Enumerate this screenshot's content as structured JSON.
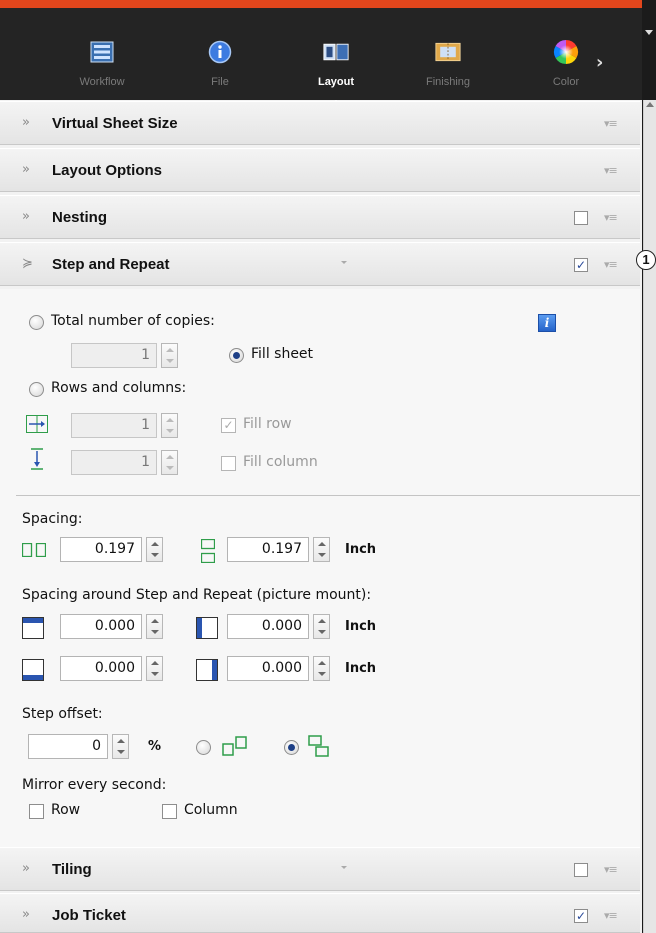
{
  "tabs": [
    {
      "label": "Workflow",
      "icon": "workflow-icon"
    },
    {
      "label": "File",
      "icon": "info-icon"
    },
    {
      "label": "Layout",
      "icon": "layout-icon",
      "active": true
    },
    {
      "label": "Finishing",
      "icon": "finishing-icon"
    },
    {
      "label": "Color",
      "icon": "color-wheel-icon"
    }
  ],
  "sections": {
    "virtual_sheet_size": {
      "title": "Virtual Sheet Size"
    },
    "layout_options": {
      "title": "Layout Options"
    },
    "nesting": {
      "title": "Nesting",
      "checked": false
    },
    "step_and_repeat": {
      "title": "Step and Repeat",
      "checked": true,
      "badge": "1"
    },
    "tiling": {
      "title": "Tiling",
      "checked": false
    },
    "job_ticket": {
      "title": "Job Ticket",
      "checked": true
    }
  },
  "step_repeat": {
    "total_copies_label": "Total number of copies:",
    "total_copies_value": "1",
    "fill_sheet_label": "Fill sheet",
    "rows_columns_label": "Rows and columns:",
    "rows_value": "1",
    "fill_row_label": "Fill row",
    "columns_value": "1",
    "fill_column_label": "Fill column",
    "spacing_label": "Spacing:",
    "spacing_h_value": "0.197",
    "spacing_v_value": "0.197",
    "unit": "Inch",
    "mount_label": "Spacing around Step and Repeat (picture mount):",
    "mount_top_value": "0.000",
    "mount_left_value": "0.000",
    "mount_bottom_value": "0.000",
    "mount_right_value": "0.000",
    "step_offset_label": "Step offset:",
    "step_offset_value": "0",
    "percent": "%",
    "mirror_label": "Mirror every second:",
    "mirror_row_label": "Row",
    "mirror_column_label": "Column"
  },
  "colors": {
    "accent": "#e2461c",
    "toolbar_bg": "#242424",
    "checkbox_blue": "#1d3f86"
  }
}
